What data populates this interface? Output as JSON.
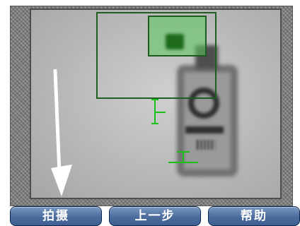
{
  "buttons": {
    "capture_label": "拍摄",
    "previous_label": "上一步",
    "help_label": "帮助"
  },
  "colors": {
    "button_blue": "#4b6b9c",
    "overlay_green": "#18c018",
    "detection_box": "#1e5e1e"
  },
  "icons": {
    "arrow": "down-arrow-icon"
  }
}
